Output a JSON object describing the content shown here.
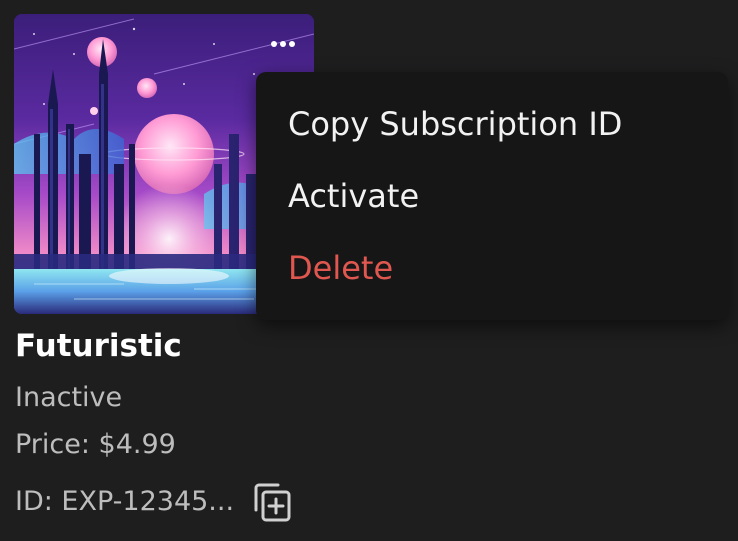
{
  "item": {
    "title": "Futuristic",
    "status": "Inactive",
    "price": "Price: $4.99",
    "id": "ID: EXP-12345..."
  },
  "menu": {
    "copy_label": "Copy Subscription ID",
    "activate_label": "Activate",
    "delete_label": "Delete"
  },
  "icons": {
    "more": "more-horizontal-icon",
    "copy": "copy-plus-icon"
  },
  "colors": {
    "background": "#1e1e1f",
    "menu_background": "#161617",
    "delete": "#e0574f",
    "secondary_text": "#bdbdbd"
  }
}
